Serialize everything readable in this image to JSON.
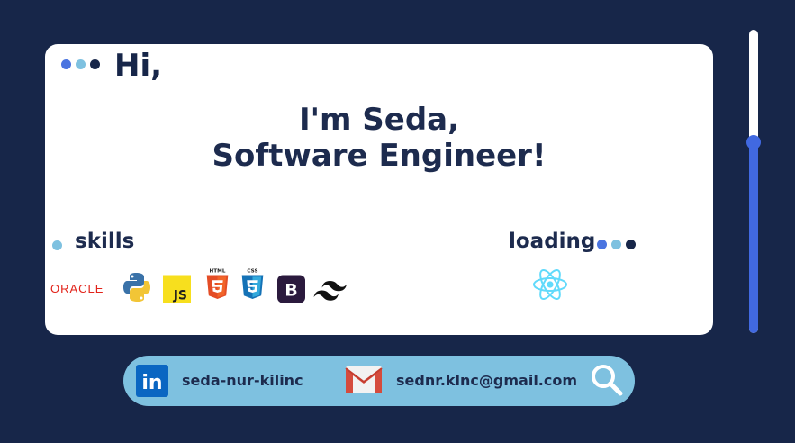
{
  "intro": {
    "greeting": "Hi,",
    "line1": "I'm Seda,",
    "line2": "Software Engineer!"
  },
  "dot_colors": [
    "#4a74e0",
    "#7ec1e0",
    "#172649"
  ],
  "skills": {
    "title": "skills",
    "oracle_label": "ORACLE",
    "js_label": "JS",
    "html_label": "HTML",
    "css_label": "CSS",
    "bootstrap_label": "B",
    "icons": [
      "oracle-logo",
      "python-logo",
      "javascript-logo",
      "html5-logo",
      "css3-logo",
      "bootstrap-logo",
      "tailwind-logo"
    ]
  },
  "loading": {
    "title": "loading",
    "icons": [
      "react-logo"
    ]
  },
  "scroll": {
    "position": 0.37
  },
  "contact": {
    "linkedin_label": "seda-nur-kilinc",
    "linkedin_icon_text": "in",
    "email_label": "sednr.klnc@gmail.com"
  },
  "colors": {
    "background": "#172649",
    "accent": "#4169e1",
    "contact_bar": "#7ec1e0"
  }
}
